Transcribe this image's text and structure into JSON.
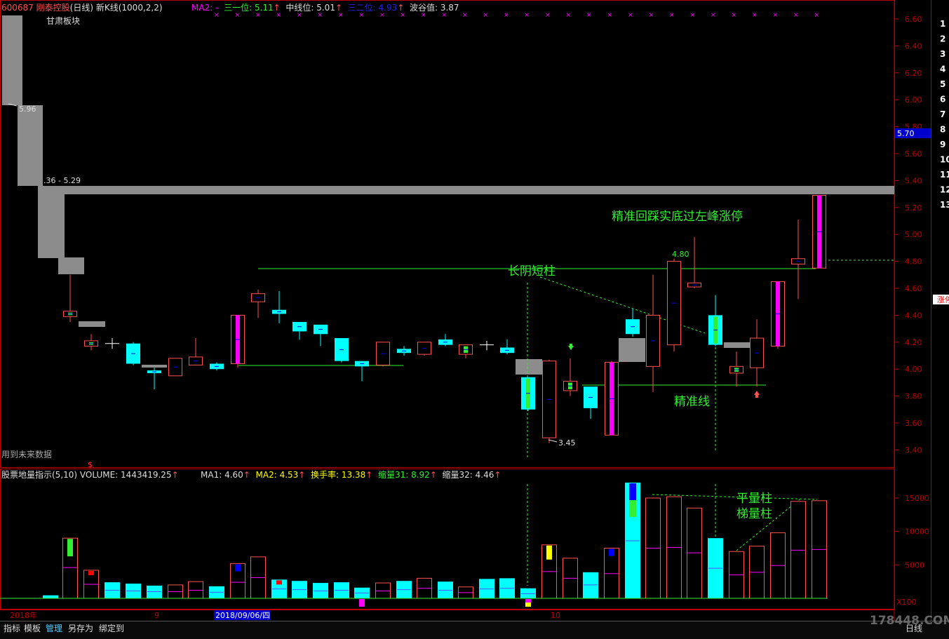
{
  "header": {
    "stock_code": "600687",
    "stock_name": "刚泰控股",
    "period": "(日线)",
    "indicator": "新K线(1000,2,2)",
    "ma2_label": "MA2:",
    "ma2_value": "-",
    "sanyi_label": "三一位:",
    "sanyi_value": "5.11",
    "zhongxian_label": "中线位:",
    "zhongxian_value": "5.01",
    "saner_label": "三二位:",
    "saner_value": "4.93",
    "bogu_label": "波谷值:",
    "bogu_value": "3.87",
    "sector": "甘肃板块"
  },
  "main_chart": {
    "price_ticks": [
      "6.60",
      "6.40",
      "6.20",
      "6.00",
      "5.80",
      "5.60",
      "5.40",
      "5.20",
      "5.00",
      "4.80",
      "4.60",
      "4.40",
      "4.20",
      "4.00",
      "3.80",
      "3.60",
      "3.40"
    ],
    "current_price": "5.70",
    "label_596": "5.96",
    "label_range": ".36 - 5.29",
    "label_480": "4.80",
    "label_345": "3.45",
    "annotation_top": "精准回踩实底过左峰涨停",
    "annotation_changyin": "长阴短柱",
    "annotation_jingzhun": "精准线",
    "future_data": "用到未来数据",
    "side_badge": "涨停"
  },
  "volume_panel": {
    "title": "股票地量指示(5,10)",
    "volume_label": "VOLUME:",
    "volume_value": "1443419.25",
    "ma1_label": "MA1:",
    "ma1_value": "4.60",
    "ma2_label": "MA2:",
    "ma2_value": "4.53",
    "turnover_label": "换手率:",
    "turnover_value": "13.38",
    "suo31_label": "缩量31:",
    "suo31_value": "8.92",
    "suo32_label": "缩量32:",
    "suo32_value": "4.46",
    "vol_ticks": [
      "15000",
      "10000",
      "5000"
    ],
    "multiplier": "X100",
    "annotation_ping": "平量柱",
    "annotation_ti": "梯量柱"
  },
  "date_axis": {
    "year": "2018年",
    "month9": "9",
    "selected": "2018/09/06/四",
    "month10": "10"
  },
  "right_column": [
    "1",
    "2",
    "3",
    "4",
    "5",
    "6",
    "7",
    "8",
    "9",
    "10",
    "11",
    "12",
    "13"
  ],
  "bottom_tabs": [
    "指标",
    "模板",
    "管理",
    "另存为",
    "绑定到"
  ],
  "bottom_right": "日线",
  "watermark": "178448.COM",
  "colors": {
    "up": "#ff5050",
    "down": "#00ffff",
    "gray": "#8c8c8c",
    "green": "#33ee33",
    "magenta": "#ff00ff"
  }
}
